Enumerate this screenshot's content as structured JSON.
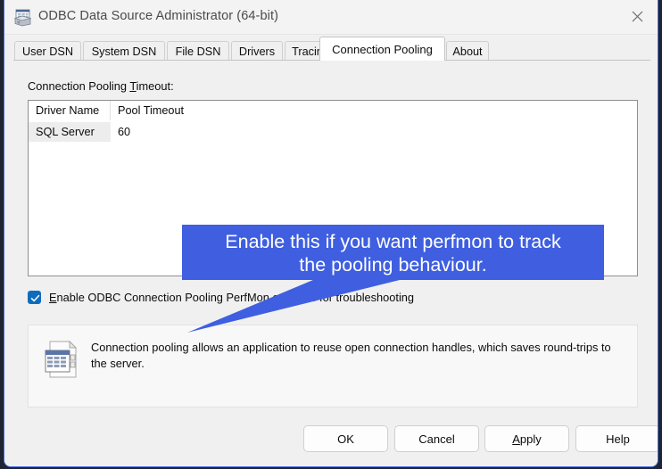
{
  "window": {
    "title": "ODBC Data Source Administrator (64-bit)",
    "icon": "odbc-admin-icon",
    "close_label": "✕",
    "accent_border": "#4b6ad8"
  },
  "tabs": [
    {
      "label": "User DSN",
      "active": false
    },
    {
      "label": "System DSN",
      "active": false
    },
    {
      "label": "File DSN",
      "active": false
    },
    {
      "label": "Drivers",
      "active": false
    },
    {
      "label": "Tracing",
      "active": false
    },
    {
      "label": "Connection Pooling",
      "active": true
    },
    {
      "label": "About",
      "active": false
    }
  ],
  "page": {
    "field_label_pre": "Connection Pooling ",
    "field_label_accel": "T",
    "field_label_post": "imeout:",
    "list": {
      "columns": [
        "Driver Name",
        "Pool Timeout"
      ],
      "rows": [
        {
          "driver_name": "SQL Server",
          "pool_timeout": "60"
        }
      ]
    },
    "checkbox": {
      "checked": true,
      "label_accel": "E",
      "label_rest": "nable ODBC Connection Pooling PerfMon counters for troubleshooting"
    },
    "info": {
      "icon": "document-table-icon",
      "text": "Connection pooling allows an application to reuse open connection handles, which saves round-trips to the server."
    }
  },
  "annotation": {
    "line1": "Enable this if you want perfmon to track",
    "line2": "the pooling behaviour.",
    "color": "#3f5fe0",
    "text_color": "#ffffff"
  },
  "footer": {
    "buttons": [
      {
        "label": "OK",
        "accel": ""
      },
      {
        "label": "Cancel",
        "accel": ""
      },
      {
        "label": "Apply",
        "accel": "A"
      },
      {
        "label": "Help",
        "accel": ""
      }
    ]
  }
}
